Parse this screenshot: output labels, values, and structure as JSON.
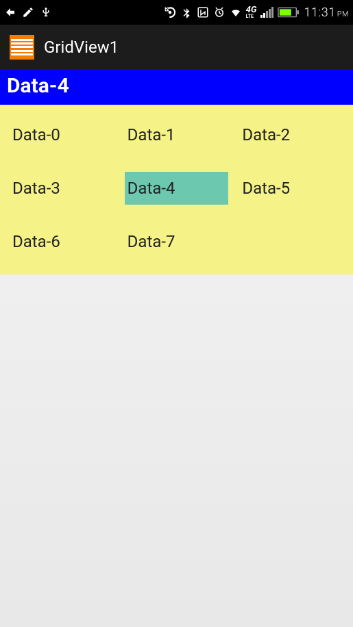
{
  "status": {
    "time": "11:31",
    "time_suffix": "PM",
    "network_label": "4G",
    "network_sub": "LTE"
  },
  "actionbar": {
    "title": "GridView1"
  },
  "header": {
    "selected_label": "Data-4"
  },
  "grid": {
    "items": [
      {
        "label": "Data-0",
        "selected": false
      },
      {
        "label": "Data-1",
        "selected": false
      },
      {
        "label": "Data-2",
        "selected": false
      },
      {
        "label": "Data-3",
        "selected": false
      },
      {
        "label": "Data-4",
        "selected": true
      },
      {
        "label": "Data-5",
        "selected": false
      },
      {
        "label": "Data-6",
        "selected": false
      },
      {
        "label": "Data-7",
        "selected": false
      }
    ]
  }
}
